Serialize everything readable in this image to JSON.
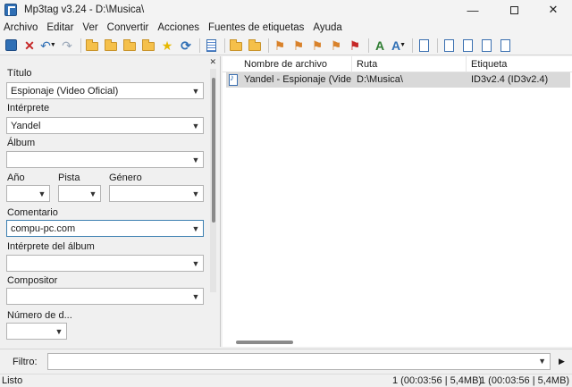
{
  "window": {
    "title": "Mp3tag v3.24  -  D:\\Musica\\",
    "minimize": "—",
    "close": "✕"
  },
  "menu": [
    "Archivo",
    "Editar",
    "Ver",
    "Convertir",
    "Acciones",
    "Fuentes de etiquetas",
    "Ayuda"
  ],
  "tag_panel": {
    "close": "✕",
    "titulo_label": "Título",
    "titulo_value": "Espionaje (Video Oficial)",
    "interprete_label": "Intérprete",
    "interprete_value": "Yandel",
    "album_label": "Álbum",
    "album_value": "",
    "anio_label": "Año",
    "pista_label": "Pista",
    "genero_label": "Género",
    "comentario_label": "Comentario",
    "comentario_value": "compu-pc.com",
    "interprete_album_label": "Intérprete del álbum",
    "compositor_label": "Compositor",
    "numero_disco_label": "Número de d..."
  },
  "file_list": {
    "columns": [
      "Nombre de archivo",
      "Ruta",
      "Etiqueta"
    ],
    "rows": [
      {
        "filename": "Yandel - Espionaje (Vide...",
        "path": "D:\\Musica\\",
        "tag": "ID3v2.4 (ID3v2.4)"
      }
    ]
  },
  "filter": {
    "label": "Filtro:",
    "value": ""
  },
  "status": {
    "text": "Listo",
    "selected": "1 (00:03:56 | 5,4MB)",
    "total": "1 (00:03:56 | 5,4MB)"
  },
  "colors": {
    "accent": "#2f6fb5",
    "selection": "#d9d9d9",
    "delete_red": "#c62828"
  }
}
